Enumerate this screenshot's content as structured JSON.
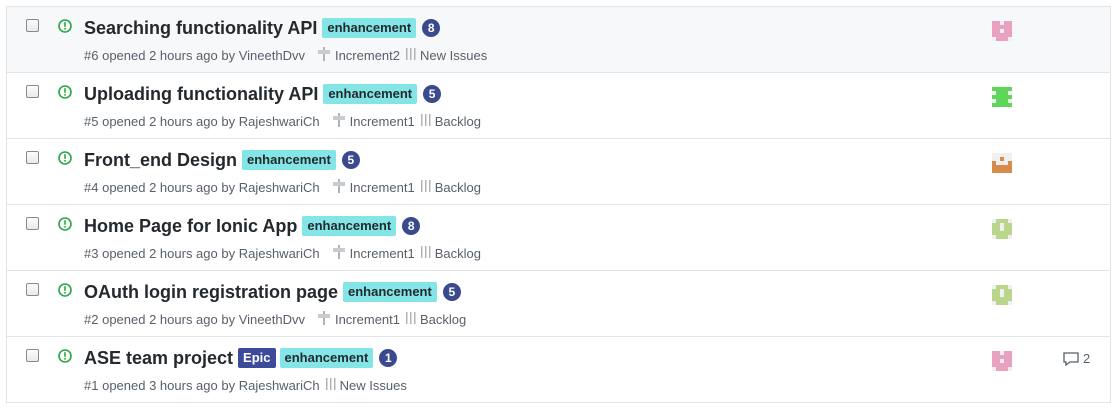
{
  "issues": [
    {
      "title": "Searching functionality API",
      "labels": [
        {
          "name": "enhancement",
          "kind": "enh"
        }
      ],
      "estimate": "8",
      "number": "#6",
      "opened": "opened 2 hours ago by",
      "author": "VineethDvv",
      "milestone": "Increment2",
      "pipeline": "New Issues",
      "avatar": "pink",
      "comments": "",
      "hover": true
    },
    {
      "title": "Uploading functionality API",
      "labels": [
        {
          "name": "enhancement",
          "kind": "enh"
        }
      ],
      "estimate": "5",
      "number": "#5",
      "opened": "opened 2 hours ago by",
      "author": "RajeshwariCh",
      "milestone": "Increment1",
      "pipeline": "Backlog",
      "avatar": "green",
      "comments": ""
    },
    {
      "title": "Front_end Design",
      "labels": [
        {
          "name": "enhancement",
          "kind": "enh"
        }
      ],
      "estimate": "5",
      "number": "#4",
      "opened": "opened 2 hours ago by",
      "author": "RajeshwariCh",
      "milestone": "Increment1",
      "pipeline": "Backlog",
      "avatar": "orange",
      "comments": ""
    },
    {
      "title": "Home Page for Ionic App",
      "labels": [
        {
          "name": "enhancement",
          "kind": "enh"
        }
      ],
      "estimate": "8",
      "number": "#3",
      "opened": "opened 2 hours ago by",
      "author": "RajeshwariCh",
      "milestone": "Increment1",
      "pipeline": "Backlog",
      "avatar": "olive",
      "comments": ""
    },
    {
      "title": "OAuth login registration page",
      "labels": [
        {
          "name": "enhancement",
          "kind": "enh"
        }
      ],
      "estimate": "5",
      "number": "#2",
      "opened": "opened 2 hours ago by",
      "author": "VineethDvv",
      "milestone": "Increment1",
      "pipeline": "Backlog",
      "avatar": "olive",
      "comments": ""
    },
    {
      "title": "ASE team project",
      "labels": [
        {
          "name": "Epic",
          "kind": "epic"
        },
        {
          "name": "enhancement",
          "kind": "enh"
        }
      ],
      "estimate": "1",
      "number": "#1",
      "opened": "opened 3 hours ago by",
      "author": "RajeshwariCh",
      "milestone": "",
      "pipeline": "New Issues",
      "avatar": "pink",
      "comments": "2"
    }
  ],
  "colors": {
    "open_icon": "#28a745",
    "enhancement": "#84e5e7",
    "epic": "#3c4a9a",
    "estimate": "#3a4a8c",
    "avatar_pink": "#e8a2c0",
    "avatar_green": "#5fd65a",
    "avatar_orange": "#d88c4a",
    "avatar_olive": "#b9d68c"
  },
  "icons": {
    "state": "issue-opened-icon",
    "milestone": "milestone-icon",
    "pipeline": "pipeline-icon",
    "comments": "comment-icon"
  }
}
